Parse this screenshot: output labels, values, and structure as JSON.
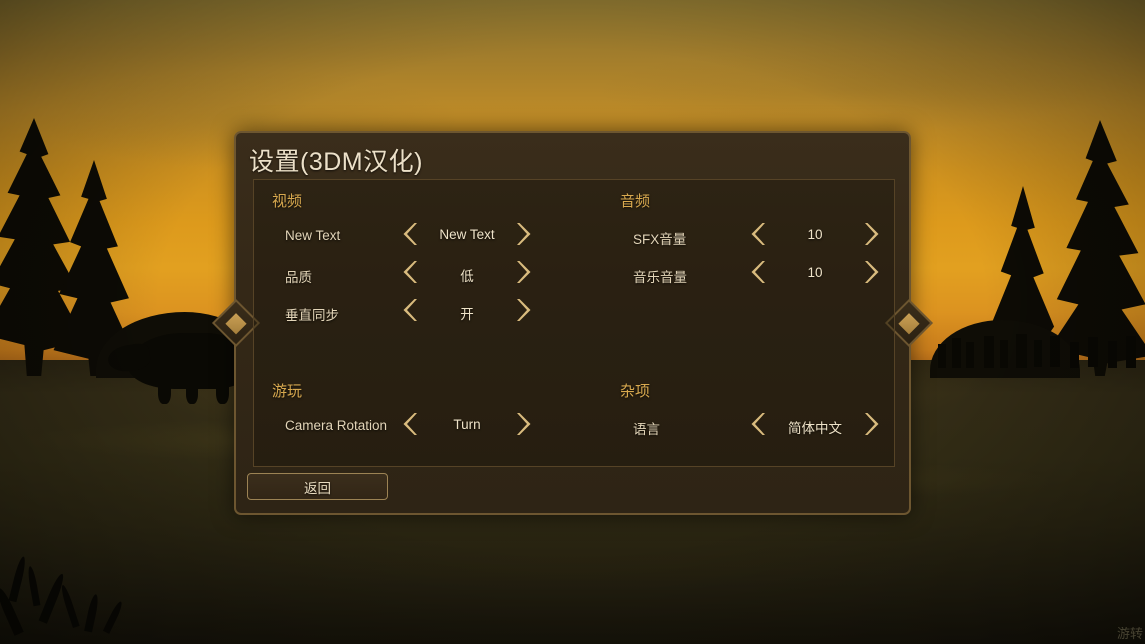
{
  "panel": {
    "title": "设置(3DM汉化)",
    "back_label": "返回"
  },
  "groups": {
    "video": {
      "title": "视频",
      "rows": [
        {
          "label": "New Text",
          "value": "New Text"
        },
        {
          "label": "品质",
          "value": "低"
        },
        {
          "label": "垂直同步",
          "value": "开"
        }
      ]
    },
    "audio": {
      "title": "音频",
      "rows": [
        {
          "label": "SFX音量",
          "value": "10"
        },
        {
          "label": "音乐音量",
          "value": "10"
        }
      ]
    },
    "gameplay": {
      "title": "游玩",
      "rows": [
        {
          "label": "Camera Rotation",
          "value": "Turn"
        }
      ]
    },
    "misc": {
      "title": "杂项",
      "rows": [
        {
          "label": "语言",
          "value": "简体中文"
        }
      ]
    }
  },
  "background": {
    "watermark": "游转"
  },
  "colors": {
    "panel_bg": "#342817",
    "panel_border": "#6d5630",
    "title_text": "#ece0c8",
    "group_title": "#d8a94f",
    "row_label": "#e3d5b8",
    "value_text": "#efe3c8",
    "chevron": "#d9bb7e",
    "sky_top": "#8a7430",
    "sky_horizon": "#e2a020",
    "ground": "#322c15"
  }
}
